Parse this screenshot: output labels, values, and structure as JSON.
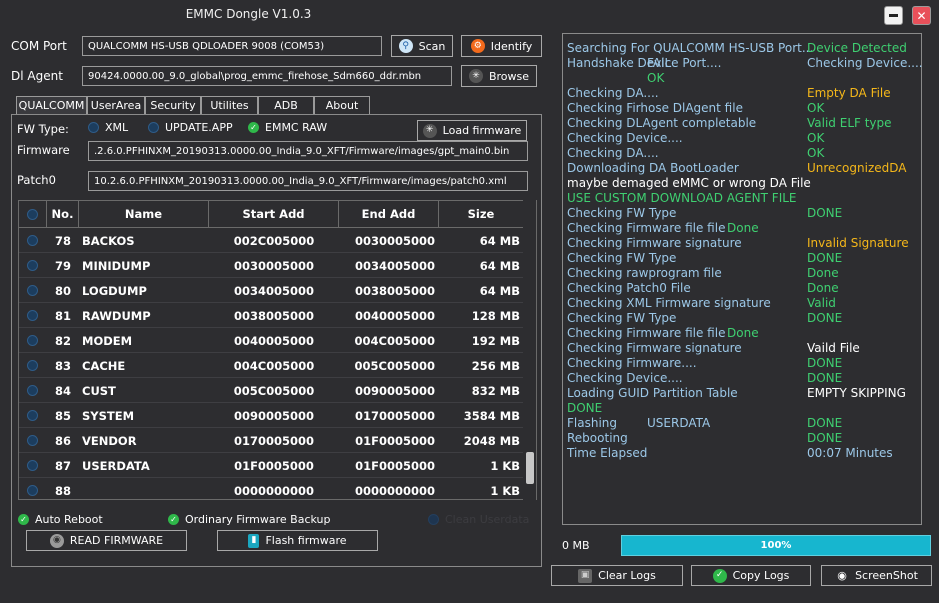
{
  "window": {
    "title": "EMMC Dongle V1.0.3"
  },
  "com_port": {
    "label": "COM Port",
    "value": "QUALCOMM HS-USB QDLOADER 9008 (COM53)",
    "scan_label": "Scan",
    "identify_label": "Identify"
  },
  "dl_agent": {
    "label": "Dl Agent",
    "value": "90424.0000.00_9.0_global\\prog_emmc_firehose_Sdm660_ddr.mbn",
    "browse_label": "Browse"
  },
  "tabs": [
    "QUALCOMM",
    "UserArea",
    "Security",
    "Utilites",
    "ADB",
    "About"
  ],
  "fw": {
    "type_label": "FW Type:",
    "options": [
      "XML",
      "UPDATE.APP",
      "EMMC RAW"
    ],
    "load_label": "Load firmware",
    "firmware_label": "Firmware",
    "firmware_value": ".2.6.0.PFHINXM_20190313.0000.00_India_9.0_XFT/Firmware/images/gpt_main0.bin",
    "patch_label": "Patch0",
    "patch_value": "10.2.6.0.PFHINXM_20190313.0000.00_India_9.0_XFT/Firmware/images/patch0.xml"
  },
  "table": {
    "headers": [
      "No.",
      "Name",
      "Start Add",
      "End Add",
      "Size"
    ],
    "rows": [
      {
        "no": "78",
        "name": "BACKOS",
        "start": "002C005000",
        "end": "0030005000",
        "size": "64 MB"
      },
      {
        "no": "79",
        "name": "MINIDUMP",
        "start": "0030005000",
        "end": "0034005000",
        "size": "64 MB"
      },
      {
        "no": "80",
        "name": "LOGDUMP",
        "start": "0034005000",
        "end": "0038005000",
        "size": "64 MB"
      },
      {
        "no": "81",
        "name": "RAWDUMP",
        "start": "0038005000",
        "end": "0040005000",
        "size": "128 MB"
      },
      {
        "no": "82",
        "name": "MODEM",
        "start": "0040005000",
        "end": "004C005000",
        "size": "192 MB"
      },
      {
        "no": "83",
        "name": "CACHE",
        "start": "004C005000",
        "end": "005C005000",
        "size": "256 MB"
      },
      {
        "no": "84",
        "name": "CUST",
        "start": "005C005000",
        "end": "0090005000",
        "size": "832 MB"
      },
      {
        "no": "85",
        "name": "SYSTEM",
        "start": "0090005000",
        "end": "0170005000",
        "size": "3584 MB"
      },
      {
        "no": "86",
        "name": "VENDOR",
        "start": "0170005000",
        "end": "01F0005000",
        "size": "2048 MB"
      },
      {
        "no": "87",
        "name": "USERDATA",
        "start": "01F0005000",
        "end": "01F0005000",
        "size": "1 KB"
      },
      {
        "no": "88",
        "name": "",
        "start": "0000000000",
        "end": "0000000000",
        "size": "1 KB"
      }
    ]
  },
  "options": {
    "auto_reboot": "Auto Reboot",
    "ordinary_backup": "Ordinary Firmware Backup",
    "clean_userdata": "Clean Userdata"
  },
  "actions": {
    "read": "READ FIRMWARE",
    "flash": "Flash firmware"
  },
  "log": {
    "lines": [
      {
        "left": "Searching For QUALCOMM HS-USB Port...",
        "right": "Device Detected",
        "left_color": "#9cc8e8",
        "right_color": "#3fd071"
      },
      {
        "left": "Handshake Device Port....",
        "mid": "FAIL",
        "right": "Checking Device....",
        "left_color": "#9cc8e8",
        "mid_color": "#9cc8e8",
        "right_color": "#9cc8e8"
      },
      {
        "left": "",
        "mid2": "OK",
        "mid2_color": "#3fd071"
      },
      {
        "left": "Checking DA....",
        "right": "Empty DA File",
        "left_color": "#9cc8e8",
        "right_color": "#f4b71a"
      },
      {
        "left": "Checking Firhose DlAgent file",
        "right": "OK",
        "left_color": "#9cc8e8",
        "right_color": "#3fd071"
      },
      {
        "left": "Checking DLAgent completable",
        "right": "Valid ELF type",
        "left_color": "#9cc8e8",
        "right_color": "#3fd071"
      },
      {
        "left": "Checking Device....",
        "right": "OK",
        "left_color": "#9cc8e8",
        "right_color": "#3fd071"
      },
      {
        "left": "Checking DA....",
        "right": "OK",
        "left_color": "#9cc8e8",
        "right_color": "#3fd071"
      },
      {
        "left": "Downloading DA BootLoader",
        "right": "UnrecognizedDA",
        "left_color": "#9cc8e8",
        "right_color": "#f4b71a"
      },
      {
        "left": "maybe demaged eMMC or wrong DA File",
        "left_color": "#ffffff"
      },
      {
        "left": "USE CUSTOM DOWNLOAD AGENT FILE",
        "left_color": "#3fd071"
      },
      {
        "left": "Checking FW Type",
        "right": "DONE",
        "left_color": "#9cc8e8",
        "right_color": "#3fd071"
      },
      {
        "left": "Checking Firmware file file",
        "mid3": "Done",
        "left_color": "#9cc8e8",
        "mid3_color": "#3fd071"
      },
      {
        "left": "Checking Firmware signature",
        "right": "Invalid Signature",
        "left_color": "#9cc8e8",
        "right_color": "#f4b71a"
      },
      {
        "left": "Checking FW Type",
        "right": "DONE",
        "left_color": "#9cc8e8",
        "right_color": "#3fd071"
      },
      {
        "left": "Checking rawprogram file",
        "right": "Done",
        "left_color": "#9cc8e8",
        "right_color": "#3fd071"
      },
      {
        "left": "Checking Patch0 File",
        "right": "Done",
        "left_color": "#9cc8e8",
        "right_color": "#3fd071"
      },
      {
        "left": "Checking XML Firmware signature",
        "right": "Valid",
        "left_color": "#9cc8e8",
        "right_color": "#3fd071"
      },
      {
        "left": "Checking FW Type",
        "right": "DONE",
        "left_color": "#9cc8e8",
        "right_color": "#3fd071"
      },
      {
        "left": "Checking Firmware file file",
        "mid3": "Done",
        "left_color": "#9cc8e8",
        "mid3_color": "#3fd071"
      },
      {
        "left": "Checking Firmware signature",
        "right": "Vaild File",
        "left_color": "#9cc8e8",
        "right_color": "#ffffff"
      },
      {
        "left": "Checking Firmware....",
        "right": "DONE",
        "left_color": "#9cc8e8",
        "right_color": "#3fd071"
      },
      {
        "left": "Checking Device....",
        "right": "DONE",
        "left_color": "#9cc8e8",
        "right_color": "#3fd071"
      },
      {
        "left": "Loading GUID Partition Table",
        "right": "EMPTY SKIPPING",
        "left_color": "#9cc8e8",
        "right_color": "#ffffff"
      },
      {
        "left": "DONE",
        "left_color": "#3fd071"
      },
      {
        "left": "Flashing",
        "mid": "USERDATA",
        "right": "DONE",
        "left_color": "#9cc8e8",
        "mid_color": "#9cc8e8",
        "right_color": "#3fd071"
      },
      {
        "left": "Rebooting",
        "right": "DONE",
        "left_color": "#9cc8e8",
        "right_color": "#3fd071"
      },
      {
        "left": "Time Elapsed",
        "right": "00:07  Minutes",
        "left_color": "#9cc8e8",
        "right_color": "#9cc8e8"
      }
    ]
  },
  "status": {
    "size": "0 MB",
    "progress": 100,
    "progress_label": "100%"
  },
  "bottom": {
    "clear": "Clear Logs",
    "copy": "Copy Logs",
    "screenshot": "ScreenShot"
  },
  "icons": {
    "scan": "magnifier-icon",
    "identify": "gear-icon",
    "browse": "asterisk-icon",
    "load": "asterisk-icon",
    "read": "disc-icon",
    "flash": "chip-icon",
    "clear": "broom-icon",
    "copy": "check-icon",
    "screenshot": "camera-icon"
  },
  "colors": {
    "log_label": "#9cc8e8",
    "ok": "#3fd071",
    "warn": "#f4b71a",
    "progress": "#17b6cf"
  }
}
